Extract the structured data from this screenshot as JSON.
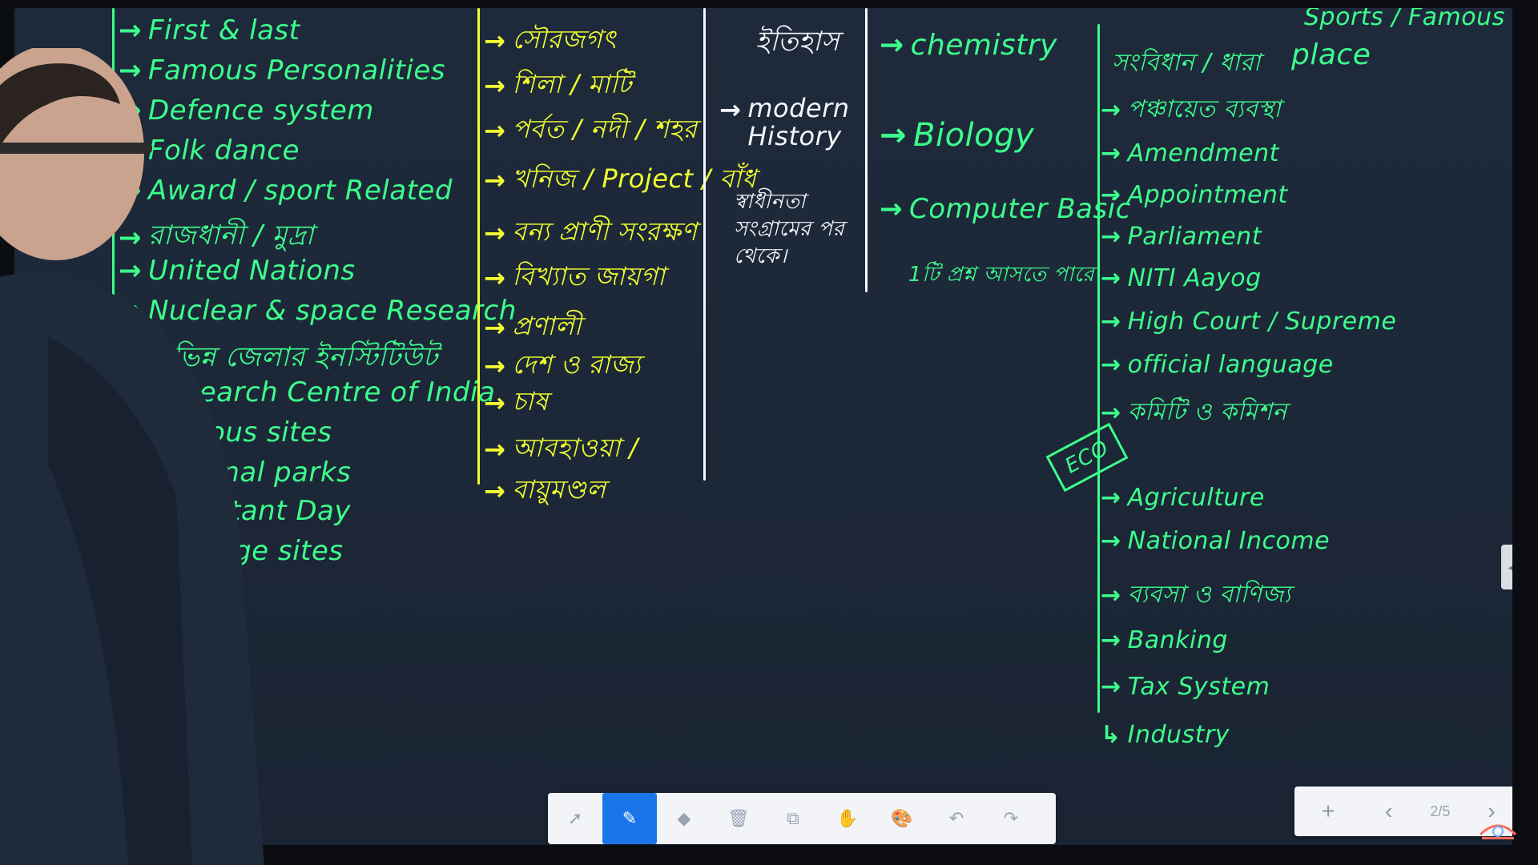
{
  "board": {
    "col1": {
      "top_partial": "...",
      "items": [
        "First & last",
        "Famous Personalities",
        "Defence system",
        "Folk dance",
        "Award / sport Related",
        "রাজধানী / মুদ্রা",
        "United Nations",
        "Nuclear & space Research",
        "বিভিন্ন জেলার ইনস্টিটিউট",
        "Research Centre of India",
        "Famous sites",
        "National parks",
        "Important Day",
        "Heritage sites"
      ]
    },
    "col2": {
      "items": [
        "সৌরজগৎ",
        "শিলা / মাটি",
        "পর্বত / নদী / শহর",
        "খনিজ / Project / বাঁধ",
        "বন্য প্রাণী সংরক্ষণ",
        "বিখ্যাত জায়গা",
        "প্রণালী",
        "দেশ ও রাজ্য",
        "চাষ",
        "আবহাওয়া /",
        "বায়ুমণ্ডল"
      ]
    },
    "col3": {
      "title": "ইতিহাস",
      "item": "modern History",
      "note": "স্বাধীনতা সংগ্রামের পর থেকে।"
    },
    "col4": {
      "items": [
        "chemistry",
        "Biology",
        "Computer Basic"
      ],
      "note": "1টি প্রশ্ন আসতে পারে"
    },
    "col5": {
      "header": "সংবিধান / ধারা",
      "items": [
        "পঞ্চায়েত ব্যবস্থা",
        "Amendment",
        "Appointment",
        "Parliament",
        "NITI Aayog",
        "High Court / Supreme",
        "official language",
        "কমিটি ও কমিশন"
      ],
      "eco_label": "ECO",
      "eco_items": [
        "Agriculture",
        "National Income",
        "ব্যবসা ও বাণিজ্য",
        "Banking",
        "Tax System",
        "Industry"
      ]
    },
    "col6": {
      "top": "Sports / Famous",
      "item": "place"
    }
  },
  "toolbar": {
    "tools": [
      {
        "name": "select-tool",
        "icon": "cursor-icon",
        "glyph": "➚"
      },
      {
        "name": "pen-tool",
        "icon": "pen-icon",
        "glyph": "✎"
      },
      {
        "name": "eraser-tool",
        "icon": "eraser-icon",
        "glyph": "◆"
      },
      {
        "name": "delete-tool",
        "icon": "trash-icon",
        "glyph": "🗑"
      },
      {
        "name": "shape-tool",
        "icon": "shapes-icon",
        "glyph": "⧉"
      },
      {
        "name": "hand-tool",
        "icon": "hand-icon",
        "glyph": "✋"
      },
      {
        "name": "palette-tool",
        "icon": "palette-icon",
        "glyph": "🎨"
      },
      {
        "name": "undo-tool",
        "icon": "undo-icon",
        "glyph": "↶"
      },
      {
        "name": "redo-tool",
        "icon": "redo-icon",
        "glyph": "↷"
      }
    ],
    "active": "pen-tool"
  },
  "pager": {
    "add": "+",
    "prev": "‹",
    "page": "2/5",
    "next": "›"
  },
  "colors": {
    "green_ink": "#3cff8c",
    "yellow_ink": "#f2ff2e",
    "white_ink": "#f4f6fb",
    "board": "#1d2838",
    "accent": "#1a76e8"
  }
}
